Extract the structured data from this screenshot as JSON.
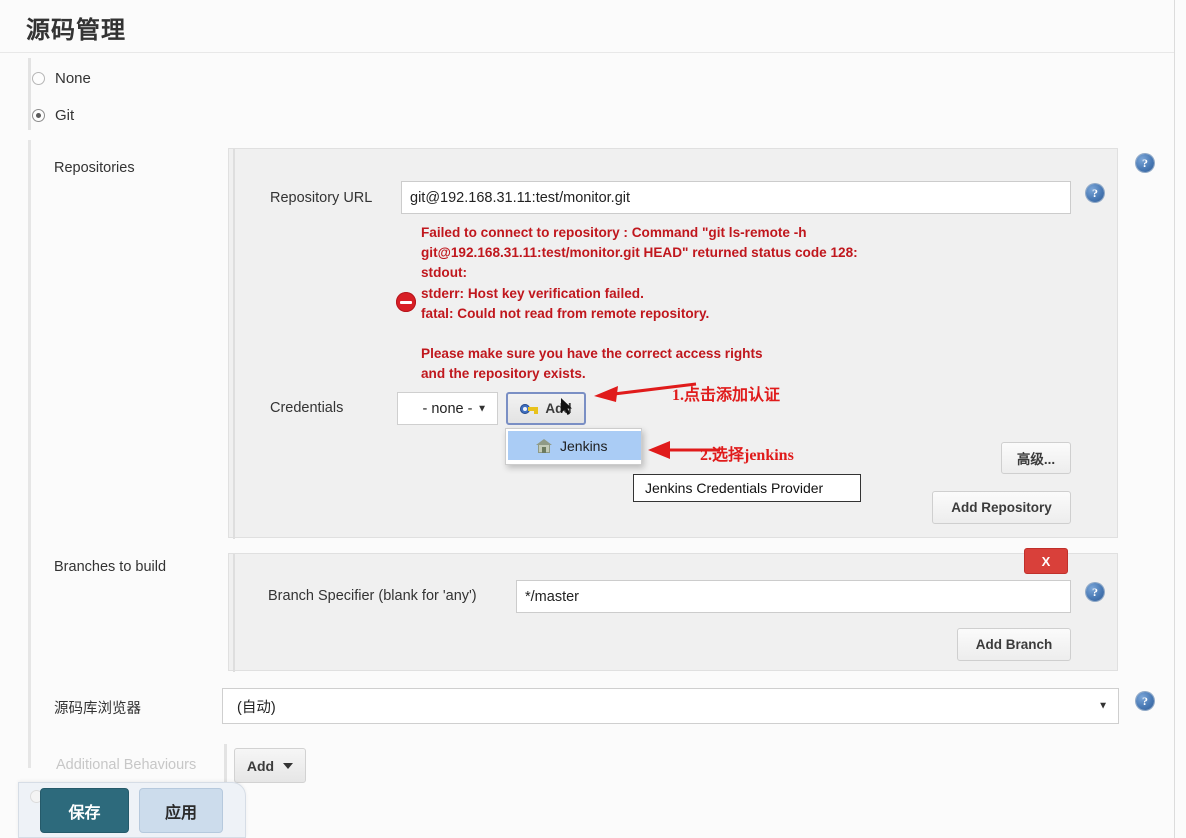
{
  "page": {
    "section_title": "源码管理"
  },
  "scm_options": [
    {
      "label": "None",
      "selected": false
    },
    {
      "label": "Git",
      "selected": true
    }
  ],
  "repositories": {
    "label": "Repositories",
    "repository_url": {
      "label": "Repository URL",
      "value": "git@192.168.31.11:test/monitor.git"
    },
    "error": {
      "icon": "error-circle-icon",
      "text": "Failed to connect to repository : Command \"git ls-remote -h\ngit@192.168.31.11:test/monitor.git HEAD\" returned status code 128:\nstdout:\nstderr: Host key verification failed.\nfatal: Could not read from remote repository.\n\nPlease make sure you have the correct access rights\nand the repository exists.",
      "color": "#c0171d"
    },
    "credentials": {
      "label": "Credentials",
      "selected_value": "- none -",
      "add_button_label": "Add",
      "add_button_icon": "key-icon",
      "dropdown": {
        "items": [
          {
            "label": "Jenkins",
            "icon": "jenkins-house-icon",
            "highlighted": true
          }
        ]
      },
      "tooltip": "Jenkins Credentials Provider"
    },
    "advanced_button_label": "高级...",
    "add_repository_button_label": "Add Repository"
  },
  "branches": {
    "label": "Branches to build",
    "delete_button_label": "X",
    "branch_specifier": {
      "label": "Branch Specifier (blank for 'any')",
      "value": "*/master"
    },
    "add_branch_button_label": "Add Branch"
  },
  "repository_browser": {
    "label": "源码库浏览器",
    "selected_value": "(自动)"
  },
  "additional_behaviours": {
    "label": "Additional Behaviours",
    "add_button_label": "Add"
  },
  "annotations": [
    {
      "text": "1.点击添加认证",
      "color": "#e01b1b"
    },
    {
      "text": "2.选择jenkins",
      "color": "#e01b1b"
    }
  ],
  "footer": {
    "save_label": "保存",
    "apply_label": "应用",
    "save_color": "#2d6a7c",
    "apply_color": "#ccdcec"
  },
  "help_icon_glyph": "?"
}
